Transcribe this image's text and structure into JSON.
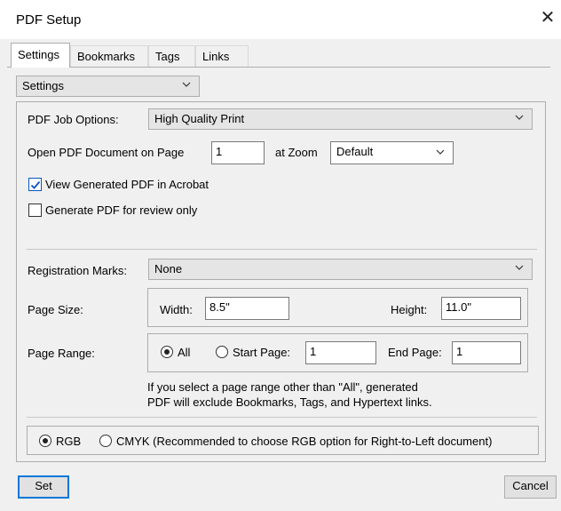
{
  "window": {
    "title": "PDF Setup",
    "close_glyph": "✕"
  },
  "tabs": [
    {
      "label": "Settings",
      "active": true
    },
    {
      "label": "Bookmarks",
      "active": false
    },
    {
      "label": "Tags",
      "active": false
    },
    {
      "label": "Links",
      "active": false
    }
  ],
  "view_select": {
    "value": "Settings"
  },
  "job_options": {
    "label": "PDF Job Options:",
    "value": "High Quality Print"
  },
  "open_page": {
    "label": "Open PDF Document on Page",
    "value": "1",
    "zoom_label": "at Zoom",
    "zoom_value": "Default"
  },
  "view_generated": {
    "label": "View Generated PDF in Acrobat",
    "checked": true
  },
  "review_only": {
    "label": "Generate PDF for review only",
    "checked": false
  },
  "registration": {
    "label": "Registration Marks:",
    "value": "None"
  },
  "page_size": {
    "label": "Page Size:",
    "width_label": "Width:",
    "width_value": "8.5\"",
    "height_label": "Height:",
    "height_value": "11.0\""
  },
  "page_range": {
    "label": "Page Range:",
    "all_label": "All",
    "all_selected": true,
    "start_label": "Start Page:",
    "start_value": "1",
    "end_label": "End Page:",
    "end_value": "1",
    "note_line1": "If you select a page range other than \"All\",  generated",
    "note_line2": "PDF will exclude Bookmarks, Tags, and Hypertext links."
  },
  "color": {
    "rgb_label": "RGB",
    "rgb_selected": true,
    "cmyk_label": "CMYK  (Recommended to choose RGB option for Right-to-Left document)"
  },
  "buttons": {
    "set": "Set",
    "cancel": "Cancel"
  },
  "colors": {
    "accent": "#0078d7",
    "check": "#0a57c2"
  },
  "icons": {
    "chevron": "chevron-down-icon",
    "check": "checkmark-icon",
    "close": "close-icon"
  }
}
